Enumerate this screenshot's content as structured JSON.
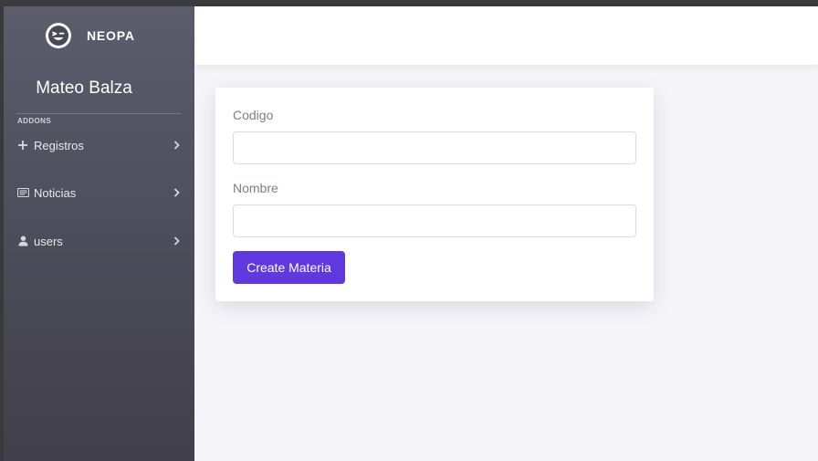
{
  "brand": {
    "name": "NEOPA",
    "logo_icon": "winking-face-icon"
  },
  "user": {
    "name": "Mateo Balza"
  },
  "sidebar": {
    "section_label": "ADDONS",
    "items": [
      {
        "label": "Registros",
        "icon": "plus-icon"
      },
      {
        "label": "Noticias",
        "icon": "newspaper-icon"
      },
      {
        "label": "users",
        "icon": "user-icon"
      }
    ]
  },
  "form": {
    "fields": [
      {
        "label": "Codigo",
        "value": "",
        "placeholder": ""
      },
      {
        "label": "Nombre",
        "value": "",
        "placeholder": ""
      }
    ],
    "submit_label": "Create Materia"
  },
  "colors": {
    "accent": "#5f38e0",
    "sidebar_top": "#5d5c6d",
    "sidebar_bottom": "#403f4a",
    "content_bg": "#f5f5f9"
  }
}
